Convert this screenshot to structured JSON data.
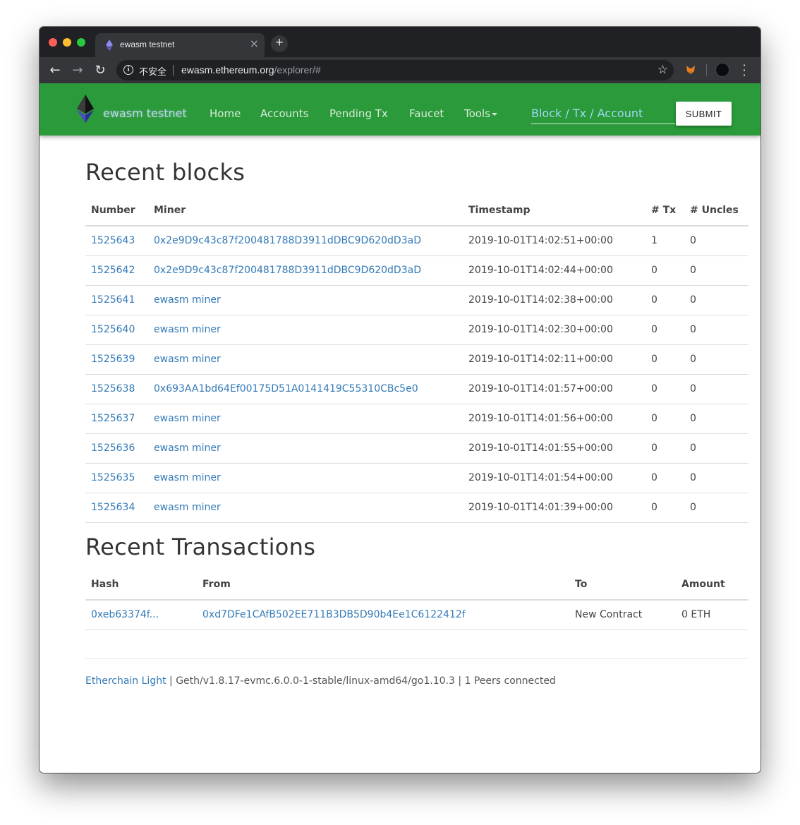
{
  "browser": {
    "tab_title": "ewasm testnet",
    "insecure_label": "不安全",
    "url_host": "ewasm.ethereum.org",
    "url_path": "/explorer/#"
  },
  "site": {
    "brand": "ewasm testnet",
    "nav": [
      {
        "label": "Home"
      },
      {
        "label": "Accounts"
      },
      {
        "label": "Pending Tx"
      },
      {
        "label": "Faucet"
      },
      {
        "label": "Tools"
      }
    ],
    "search_placeholder": "Block / Tx / Account",
    "submit_label": "SUBMIT",
    "accent_color": "#2a9a3a"
  },
  "blocks": {
    "title": "Recent blocks",
    "headers": [
      "Number",
      "Miner",
      "Timestamp",
      "# Tx",
      "# Uncles"
    ],
    "rows": [
      {
        "number": "1525643",
        "miner": "0x2e9D9c43c87f200481788D3911dDBC9D620dD3aD",
        "timestamp": "2019-10-01T14:02:51+00:00",
        "tx": "1",
        "uncles": "0"
      },
      {
        "number": "1525642",
        "miner": "0x2e9D9c43c87f200481788D3911dDBC9D620dD3aD",
        "timestamp": "2019-10-01T14:02:44+00:00",
        "tx": "0",
        "uncles": "0"
      },
      {
        "number": "1525641",
        "miner": "ewasm miner",
        "timestamp": "2019-10-01T14:02:38+00:00",
        "tx": "0",
        "uncles": "0"
      },
      {
        "number": "1525640",
        "miner": "ewasm miner",
        "timestamp": "2019-10-01T14:02:30+00:00",
        "tx": "0",
        "uncles": "0"
      },
      {
        "number": "1525639",
        "miner": "ewasm miner",
        "timestamp": "2019-10-01T14:02:11+00:00",
        "tx": "0",
        "uncles": "0"
      },
      {
        "number": "1525638",
        "miner": "0x693AA1bd64Ef00175D51A0141419C55310CBc5e0",
        "timestamp": "2019-10-01T14:01:57+00:00",
        "tx": "0",
        "uncles": "0"
      },
      {
        "number": "1525637",
        "miner": "ewasm miner",
        "timestamp": "2019-10-01T14:01:56+00:00",
        "tx": "0",
        "uncles": "0"
      },
      {
        "number": "1525636",
        "miner": "ewasm miner",
        "timestamp": "2019-10-01T14:01:55+00:00",
        "tx": "0",
        "uncles": "0"
      },
      {
        "number": "1525635",
        "miner": "ewasm miner",
        "timestamp": "2019-10-01T14:01:54+00:00",
        "tx": "0",
        "uncles": "0"
      },
      {
        "number": "1525634",
        "miner": "ewasm miner",
        "timestamp": "2019-10-01T14:01:39+00:00",
        "tx": "0",
        "uncles": "0"
      }
    ]
  },
  "transactions": {
    "title": "Recent Transactions",
    "headers": [
      "Hash",
      "From",
      "To",
      "Amount"
    ],
    "rows": [
      {
        "hash": "0xeb63374f...",
        "from": "0xd7DFe1CAfB502EE711B3DB5D90b4Ee1C6122412f",
        "to": "New Contract",
        "amount": "0 ETH"
      }
    ]
  },
  "footer": {
    "link": "Etherchain Light",
    "text": " | Geth/v1.8.17-evmc.6.0.0-1-stable/linux-amd64/go1.10.3 | 1 Peers connected"
  }
}
